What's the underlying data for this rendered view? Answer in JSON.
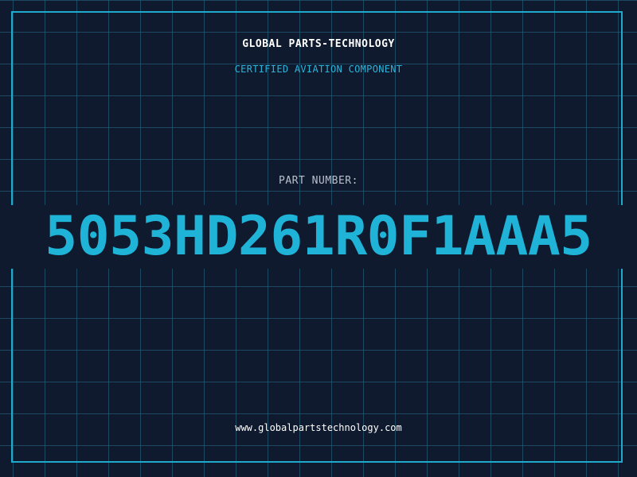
{
  "header": {
    "brand": "GLOBAL PARTS-TECHNOLOGY",
    "subtitle": "CERTIFIED AVIATION COMPONENT"
  },
  "part": {
    "label": "PART NUMBER:",
    "number": "5053HD261R0F1AAA5"
  },
  "footer": {
    "url": "www.globalpartstechnology.com"
  },
  "colors": {
    "background": "#0f1a2e",
    "grid": "#286e8c",
    "accent": "#1fb3d8",
    "label": "#b8c0cc",
    "text": "#ffffff"
  }
}
